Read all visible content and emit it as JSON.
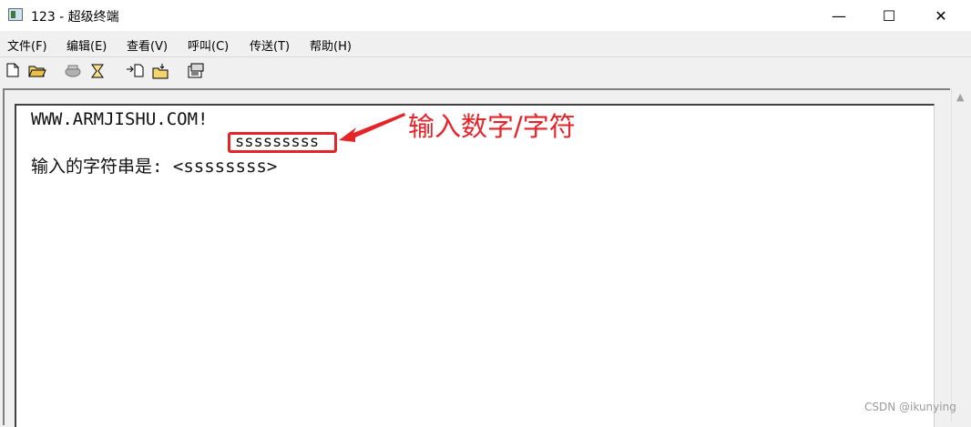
{
  "window": {
    "title": "123 - 超级终端",
    "controls": {
      "minimize": "—",
      "maximize": "☐",
      "close": "✕"
    }
  },
  "menu": {
    "items": [
      "文件(F)",
      "编辑(E)",
      "查看(V)",
      "呼叫(C)",
      "传送(T)",
      "帮助(H)"
    ]
  },
  "toolbar": {
    "icons": [
      "new-document-icon",
      "open-folder-icon",
      "phone-icon",
      "disconnect-icon",
      "send-file-icon",
      "receive-file-icon",
      "properties-icon"
    ]
  },
  "terminal": {
    "lines": [
      "WWW.ARMJISHU.COM!",
      "sssssssss",
      "输入的字符串是: <ssssssss>"
    ]
  },
  "annotation": {
    "label": "输入数字/字符",
    "color": "#e5242a"
  },
  "watermark": "CSDN @ikunying"
}
